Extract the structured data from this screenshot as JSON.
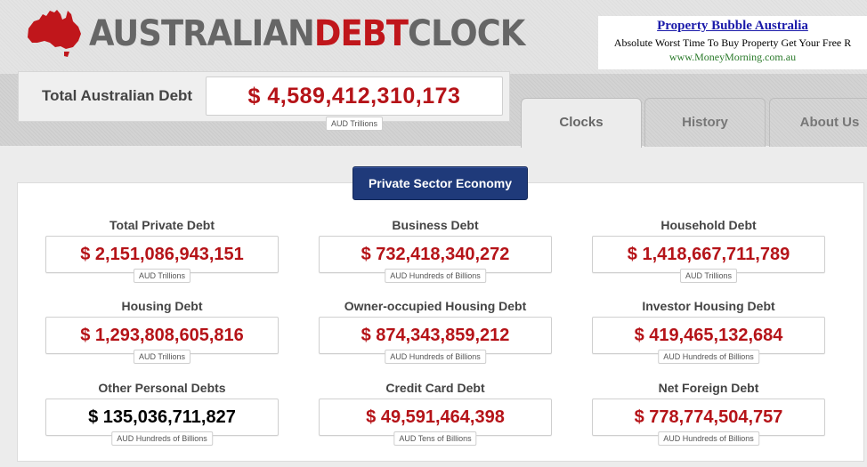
{
  "logo": {
    "part1": "AUSTRALIAN",
    "part2": "DEBT",
    "part3": "CLOCK"
  },
  "ad": {
    "title": "Property Bubble Australia",
    "text": "Absolute Worst Time To Buy Property Get Your Free R",
    "url": "www.MoneyMorning.com.au"
  },
  "total": {
    "label": "Total Australian Debt",
    "value": "$ 4,589,412,310,173",
    "unit": "AUD Trillions"
  },
  "tabs": [
    {
      "label": "Clocks"
    },
    {
      "label": "History"
    },
    {
      "label": "About Us"
    }
  ],
  "section": {
    "label": "Private Sector Economy"
  },
  "clocks": [
    {
      "label": "Total Private Debt",
      "value": "$ 2,151,086,943,151",
      "unit": "AUD Trillions"
    },
    {
      "label": "Business Debt",
      "value": "$ 732,418,340,272",
      "unit": "AUD Hundreds of Billions"
    },
    {
      "label": "Household Debt",
      "value": "$ 1,418,667,711,789",
      "unit": "AUD Trillions"
    },
    {
      "label": "Housing Debt",
      "value": "$ 1,293,808,605,816",
      "unit": "AUD Trillions"
    },
    {
      "label": "Owner-occupied Housing Debt",
      "value": "$ 874,343,859,212",
      "unit": "AUD Hundreds of Billions"
    },
    {
      "label": "Investor Housing Debt",
      "value": "$ 419,465,132,684",
      "unit": "AUD Hundreds of Billions"
    },
    {
      "label": "Other Personal Debts",
      "value": "$ 135,036,711,827",
      "unit": "AUD Hundreds of Billions"
    },
    {
      "label": "Credit Card Debt",
      "value": "$ 49,591,464,398",
      "unit": "AUD Tens of Billions"
    },
    {
      "label": "Net Foreign Debt",
      "value": "$ 778,774,504,757",
      "unit": "AUD Hundreds of Billions"
    }
  ],
  "colors": {
    "accent_red": "#b51318",
    "brand_grey": "#666666",
    "section_blue": "#1f3a7a"
  }
}
